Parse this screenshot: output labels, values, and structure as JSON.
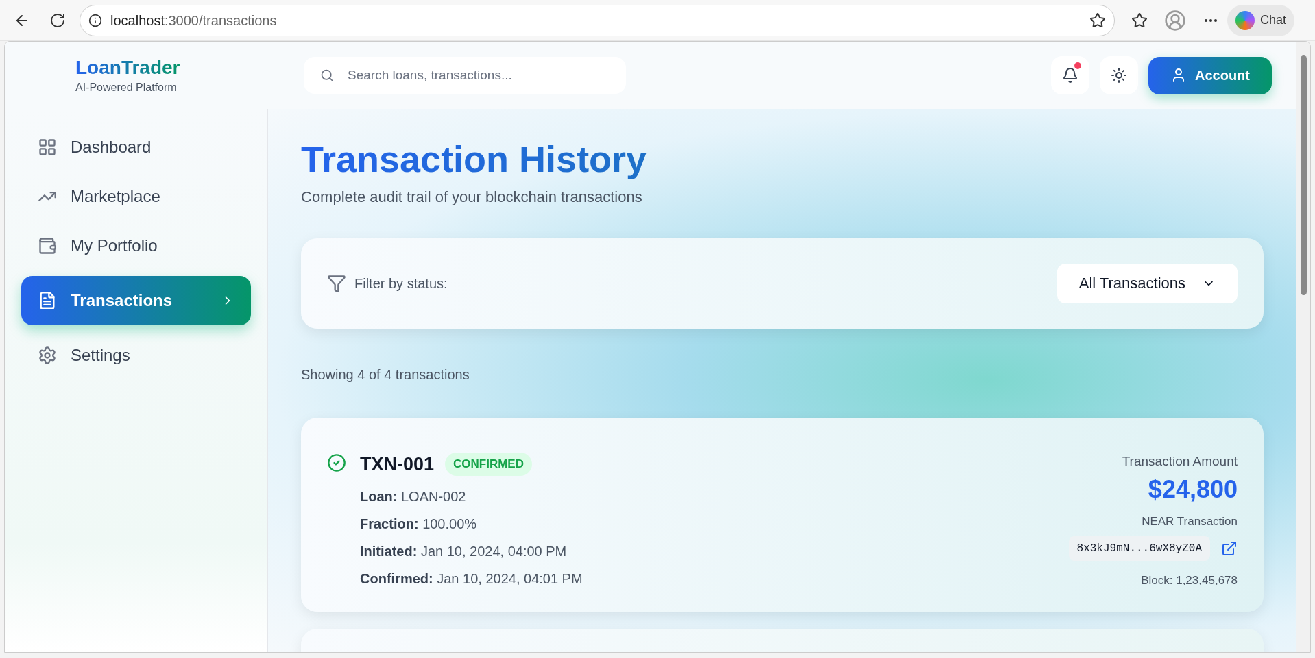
{
  "browser": {
    "url_host": "localhost",
    "url_path": ":3000/transactions",
    "chat_label": "Chat"
  },
  "brand": {
    "name": "LoanTrader",
    "tagline": "AI-Powered Platform"
  },
  "search": {
    "placeholder": "Search loans, transactions..."
  },
  "header": {
    "notification_dot": true,
    "account_label": "Account"
  },
  "sidebar": {
    "items": [
      {
        "label": "Dashboard",
        "kind": "grid",
        "selected": false
      },
      {
        "label": "Marketplace",
        "kind": "trend",
        "selected": false
      },
      {
        "label": "My Portfolio",
        "kind": "wallet",
        "selected": false
      },
      {
        "label": "Transactions",
        "kind": "document",
        "selected": true
      },
      {
        "label": "Settings",
        "kind": "gear",
        "selected": false
      }
    ]
  },
  "page": {
    "title": "Transaction History",
    "subtitle": "Complete audit trail of your blockchain transactions"
  },
  "filter": {
    "label": "Filter by status:",
    "value": "All Transactions"
  },
  "summary": "Showing 4 of 4 transactions",
  "transactions": [
    {
      "id": "TXN-001",
      "status": {
        "label": "CONFIRMED",
        "kind": "confirmed"
      },
      "details": [
        {
          "label": "Loan:",
          "value": "LOAN-002"
        },
        {
          "label": "Fraction:",
          "value": "100.00%"
        },
        {
          "label": "Initiated:",
          "value": "Jan 10, 2024, 04:00 PM"
        },
        {
          "label": "Confirmed:",
          "value": "Jan 10, 2024, 04:01 PM"
        }
      ],
      "amount_label": "Transaction Amount",
      "amount": "$24,800",
      "network_label": "NEAR Transaction",
      "hash": "8x3kJ9mN...6wX8yZ0A",
      "block": "Block: 1,23,45,678"
    }
  ]
}
